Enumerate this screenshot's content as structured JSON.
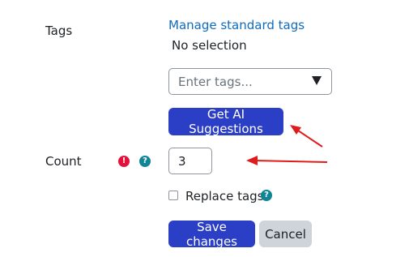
{
  "form": {
    "tags": {
      "label": "Tags",
      "manage_link": "Manage standard tags",
      "selection_text": "No selection",
      "input_placeholder": "Enter tags...",
      "ai_button": "Get AI Suggestions"
    },
    "count": {
      "label": "Count",
      "error_icon": "exclamation-icon",
      "help_icon": "question-icon",
      "value": "3"
    },
    "replace": {
      "label": "Replace tags",
      "checked": false,
      "help_icon": "question-icon"
    },
    "actions": {
      "save_label": "Save changes",
      "cancel_label": "Cancel"
    }
  },
  "colors": {
    "primary_button": "#2b3ec6",
    "secondary_button": "#ced4da",
    "link": "#0f6cbf",
    "error": "#e4123b",
    "help": "#0f8596",
    "annotation_arrow": "#e01b1b"
  }
}
